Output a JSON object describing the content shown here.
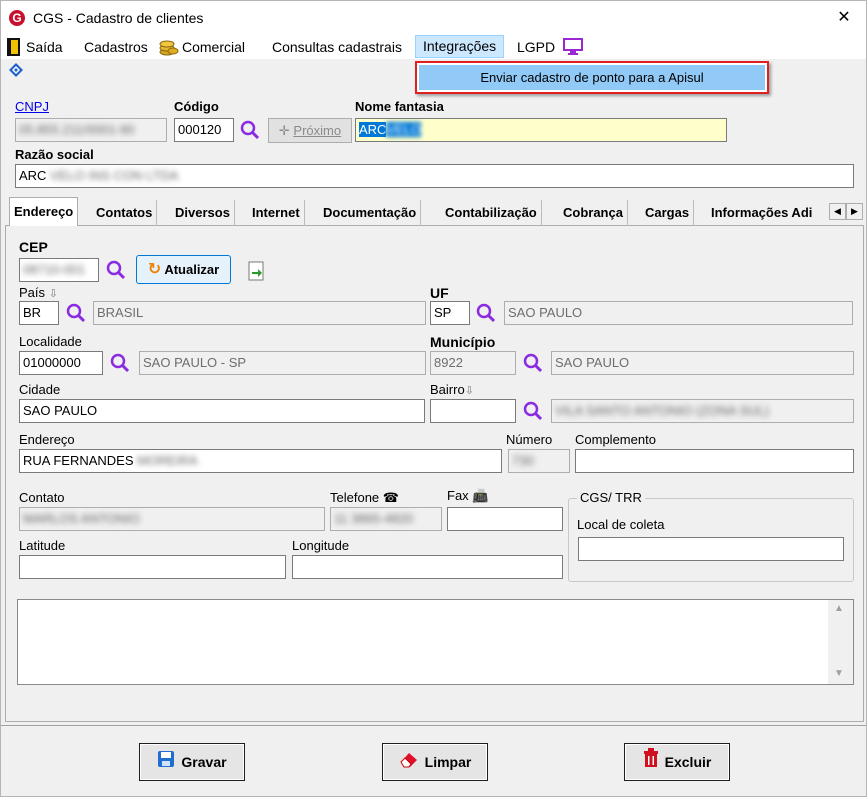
{
  "window": {
    "title": "CGS - Cadastro de clientes",
    "close_glyph": "✕",
    "logo_letter": "G"
  },
  "menu": {
    "saida": "Saída",
    "cadastros": "Cadastros",
    "comercial": "Comercial",
    "consultas": "Consultas cadastrais",
    "integracoes": "Integrações",
    "lgpd": "LGPD",
    "dropdown_item": "Enviar cadastro de ponto para a Apisul"
  },
  "header": {
    "cnpj_label": "CNPJ",
    "cnpj_value": "05.855.211/0001-90",
    "codigo_label": "Código",
    "codigo_value": "000120",
    "proximo_label": "Próximo",
    "nome_fantasia_label": "Nome fantasia",
    "nome_fantasia_value": "ARC",
    "nome_fantasia_blurred": "VELO",
    "razao_label": "Razão social",
    "razao_value": "ARC",
    "razao_blurred": "VELO INS CON LTDA"
  },
  "tabs": [
    "Endereço",
    "Contatos",
    "Diversos",
    "Internet",
    "Documentação",
    "Contabilização",
    "Cobrança",
    "Cargas",
    "Informações Adi"
  ],
  "address": {
    "cep_label": "CEP",
    "cep_value": "08710-001",
    "atualizar_label": "Atualizar",
    "pais_label": "País",
    "pais_code": "BR",
    "pais_name": "BRASIL",
    "uf_label": "UF",
    "uf_code": "SP",
    "uf_name": "SAO PAULO",
    "localidade_label": "Localidade",
    "localidade_code": "01000000",
    "localidade_name": "SAO PAULO - SP",
    "municipio_label": "Município",
    "municipio_code": "8922",
    "municipio_name": "SAO PAULO",
    "cidade_label": "Cidade",
    "cidade_value": "SAO PAULO",
    "bairro_label": "Bairro",
    "bairro_value": "",
    "bairro_name": "VILA SANTO ANTONIO (ZONA SUL)",
    "endereco_label": "Endereço",
    "endereco_value": "RUA FERNANDES",
    "endereco_blurred": "MOREIRA",
    "numero_label": "Número",
    "numero_value": "730",
    "complemento_label": "Complemento",
    "complemento_value": "",
    "contato_label": "Contato",
    "contato_value": "MARLOS ANTONIO",
    "telefone_label": "Telefone",
    "telefone_value": "11 3865-4820",
    "fax_label": "Fax",
    "fax_value": "",
    "latitude_label": "Latitude",
    "latitude_value": "",
    "longitude_label": "Longitude",
    "longitude_value": "",
    "group_label": "CGS/ TRR",
    "local_coleta_label": "Local de coleta",
    "local_coleta_value": ""
  },
  "footer": {
    "gravar": "Gravar",
    "limpar": "Limpar",
    "excluir": "Excluir"
  },
  "colors": {
    "accent": "#0078d7",
    "highlight": "#ffffcc",
    "selection": "#0078d7",
    "dropdown_border": "#e02020"
  }
}
